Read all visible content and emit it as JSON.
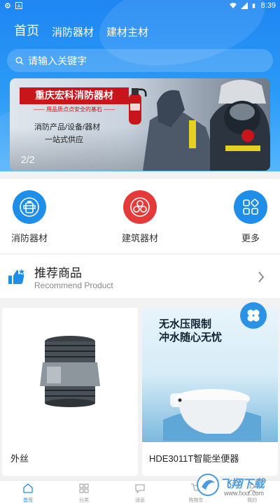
{
  "status_bar": {
    "time": "8:39"
  },
  "nav": {
    "tabs": [
      {
        "label": "首页",
        "active": true
      },
      {
        "label": "消防器材",
        "active": false
      },
      {
        "label": "建材主材",
        "active": false
      }
    ]
  },
  "search": {
    "placeholder": "请输入关键字"
  },
  "banner": {
    "title": "重庆宏科消防器材",
    "slogan": "—— 用品质点点安全的基石 ——",
    "line1": "消防产品/设备/器材",
    "line2": "一站式供应",
    "counter": "2/2"
  },
  "categories": [
    {
      "label": "消防器材",
      "icon": "fire-hydrant-icon",
      "color": "#1e8ee8"
    },
    {
      "label": "建筑器材",
      "icon": "materials-icon",
      "color": "#e53a3a"
    },
    {
      "label": "更多",
      "icon": "more-grid-icon",
      "color": "#1e8ee8"
    }
  ],
  "recommend": {
    "title": "推荐商品",
    "subtitle": "Recommend Product"
  },
  "products": [
    {
      "name": "外丝"
    },
    {
      "name": "HDE3011T智能坐便器",
      "headline1": "无水压限制",
      "headline2": "冲水随心无忧"
    }
  ],
  "tabbar": [
    {
      "label": "首页",
      "icon": "home-icon",
      "active": true
    },
    {
      "label": "分类",
      "icon": "category-icon",
      "active": false
    },
    {
      "label": "消息",
      "icon": "message-icon",
      "active": false
    },
    {
      "label": "购物车",
      "icon": "cart-icon",
      "active": false
    },
    {
      "label": "我的",
      "icon": "user-icon",
      "active": false
    }
  ],
  "watermark": {
    "title": "飞翔下载",
    "url": "www.fxxz.com"
  },
  "colors": {
    "primary": "#1f86f2",
    "accent_red": "#c8141b"
  }
}
